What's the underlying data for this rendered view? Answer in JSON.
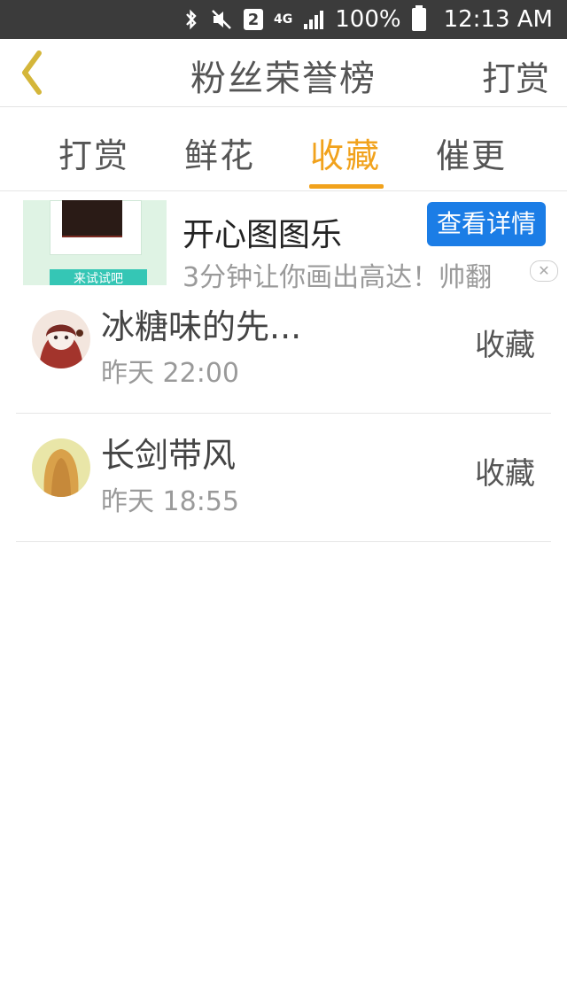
{
  "status_bar": {
    "sim_slot": "2",
    "network": "4G",
    "battery": "100%",
    "time": "12:13 AM",
    "icons": [
      "bluetooth-icon",
      "mute-icon",
      "sim-icon",
      "network-icon",
      "signal-icon",
      "battery-icon"
    ]
  },
  "header": {
    "back_icon": "chevron-left-icon",
    "title": "粉丝荣誉榜",
    "action": "打赏"
  },
  "tabs": [
    {
      "label": "打赏"
    },
    {
      "label": "鲜花"
    },
    {
      "label": "收藏",
      "active": true
    },
    {
      "label": "催更"
    }
  ],
  "ad": {
    "thumb_text": "来试试吧",
    "title": "开心图图乐",
    "button": "查看详情",
    "description": "3分钟让你画出高达！帅翻",
    "close_icon": "close-icon"
  },
  "list": [
    {
      "name": "冰糖味的先...",
      "time": "昨天 22:00",
      "action": "收藏"
    },
    {
      "name": "长剑带风",
      "time": "昨天 18:55",
      "action": "收藏"
    }
  ],
  "colors": {
    "status_bar": "#3b3b3b",
    "accent": "#f1a21c",
    "ad_button": "#1b7de6",
    "back_icon": "#d4b63a"
  }
}
